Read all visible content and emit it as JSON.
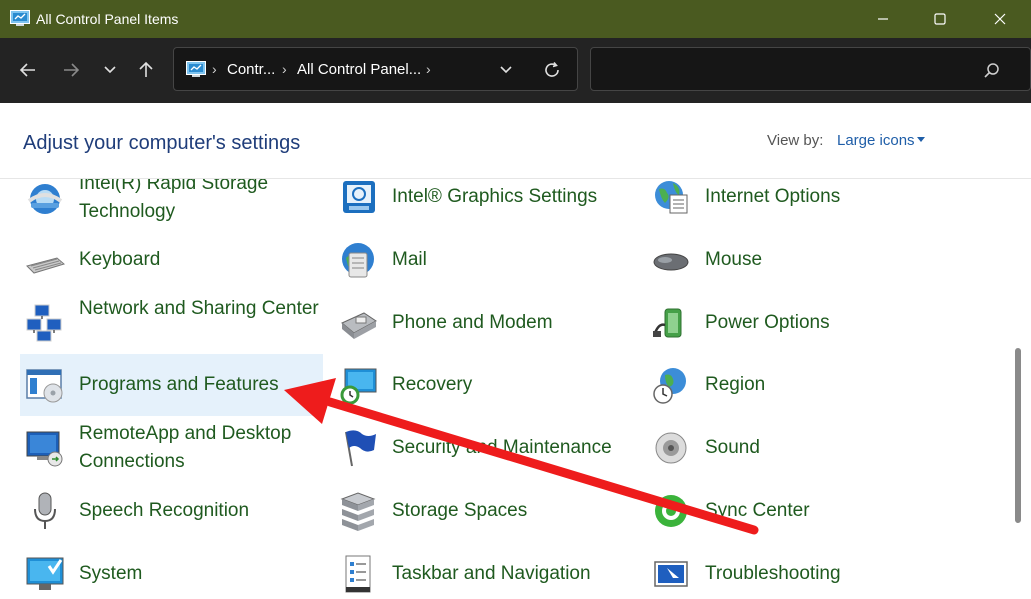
{
  "window": {
    "title": "All Control Panel Items",
    "titlebar_color": "#4a5a20",
    "buttons": [
      "minimize",
      "maximize",
      "close"
    ]
  },
  "navigation": {
    "breadcrumbs": [
      "Contr...",
      "All Control Panel..."
    ],
    "search_placeholder": ""
  },
  "header": {
    "title": "Adjust your computer's settings",
    "view_by_label": "View by:",
    "view_by_value": "Large icons"
  },
  "items": [
    {
      "label": "Intel(R) Rapid Storage Technology",
      "icon": "rapid-storage-icon"
    },
    {
      "label": "Intel® Graphics Settings",
      "icon": "intel-graphics-icon"
    },
    {
      "label": "Internet Options",
      "icon": "internet-options-icon"
    },
    {
      "label": "Keyboard",
      "icon": "keyboard-icon"
    },
    {
      "label": "Mail",
      "icon": "mail-icon"
    },
    {
      "label": "Mouse",
      "icon": "mouse-icon"
    },
    {
      "label": "Network and Sharing Center",
      "icon": "network-icon"
    },
    {
      "label": "Phone and Modem",
      "icon": "phone-modem-icon"
    },
    {
      "label": "Power Options",
      "icon": "power-options-icon"
    },
    {
      "label": "Programs and Features",
      "icon": "programs-features-icon",
      "selected": true
    },
    {
      "label": "Recovery",
      "icon": "recovery-icon"
    },
    {
      "label": "Region",
      "icon": "region-icon"
    },
    {
      "label": "RemoteApp and Desktop Connections",
      "icon": "remoteapp-icon"
    },
    {
      "label": "Security and Maintenance",
      "icon": "security-flag-icon"
    },
    {
      "label": "Sound",
      "icon": "sound-icon"
    },
    {
      "label": "Speech Recognition",
      "icon": "microphone-icon"
    },
    {
      "label": "Storage Spaces",
      "icon": "storage-spaces-icon"
    },
    {
      "label": "Sync Center",
      "icon": "sync-center-icon"
    },
    {
      "label": "System",
      "icon": "system-icon"
    },
    {
      "label": "Taskbar and Navigation",
      "icon": "taskbar-icon"
    },
    {
      "label": "Troubleshooting",
      "icon": "troubleshooting-icon"
    }
  ],
  "annotation": {
    "color": "#ee1c1c",
    "icon": "red-arrow-icon"
  }
}
